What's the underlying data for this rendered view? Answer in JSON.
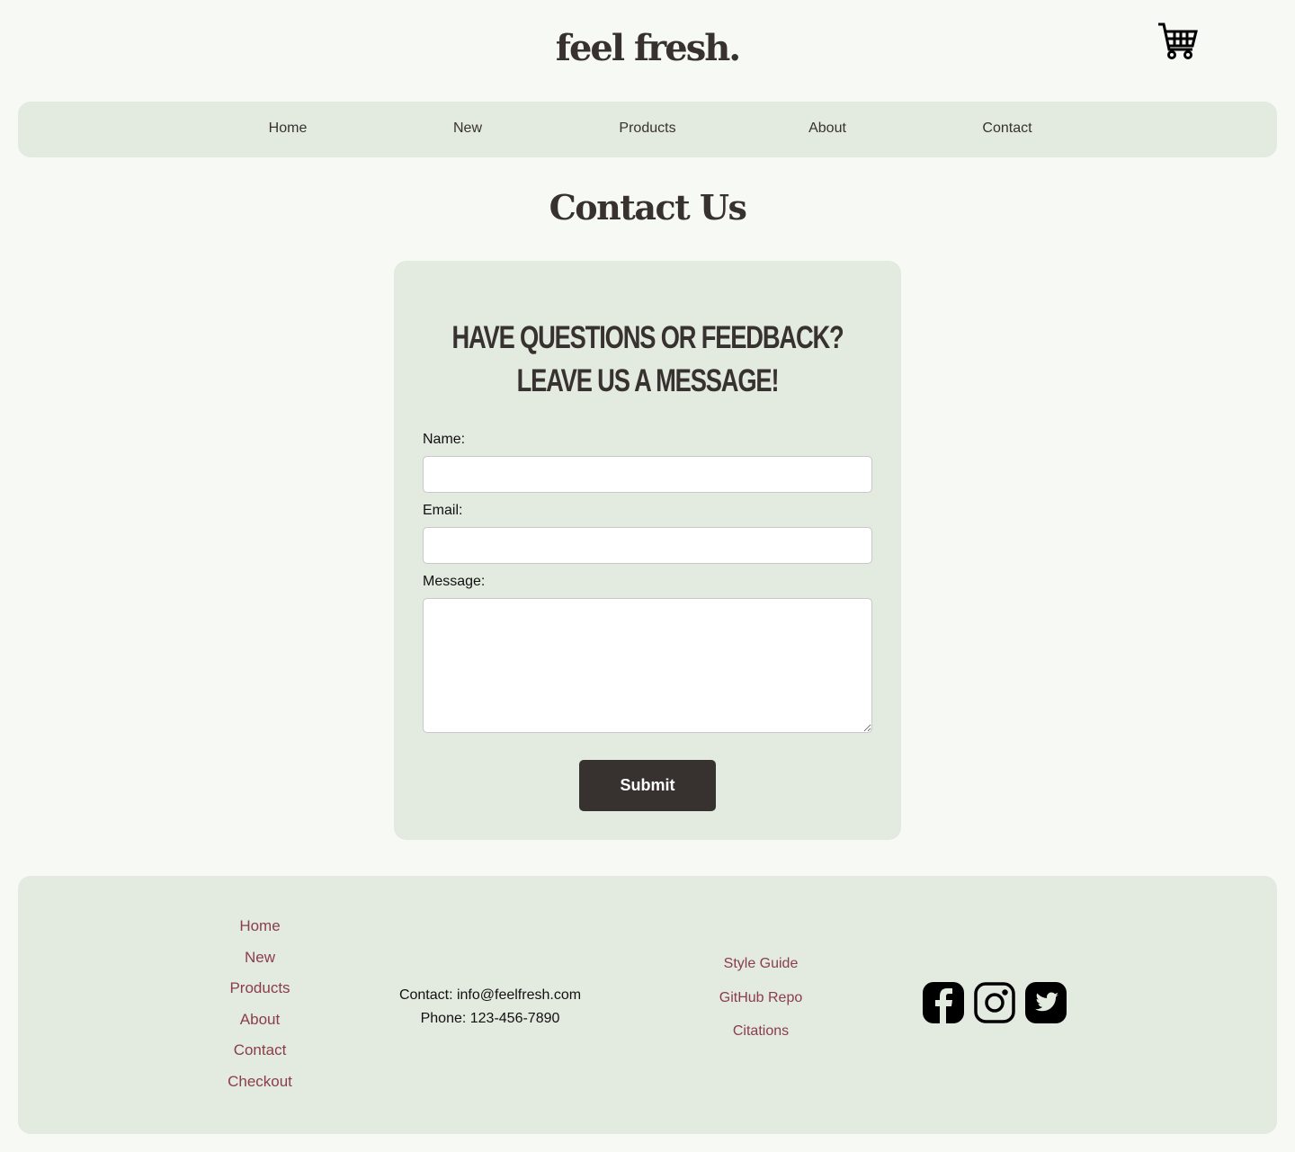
{
  "header": {
    "logo": "feel fresh.",
    "cart_icon": "cart-icon"
  },
  "nav": [
    "Home",
    "New",
    "Products",
    "About",
    "Contact"
  ],
  "page_title": "Contact Us",
  "form": {
    "heading_line1": "Have questions or feedback?",
    "heading_line2": "Leave us a message!",
    "name_label": "Name:",
    "email_label": "Email:",
    "message_label": "Message:",
    "name_value": "",
    "email_value": "",
    "message_value": "",
    "submit": "Submit"
  },
  "footer": {
    "links": [
      "Home",
      "New",
      "Products",
      "About",
      "Contact",
      "Checkout"
    ],
    "contact": "Contact: info@feelfresh.com",
    "phone": "Phone: 123-456-7890",
    "resources": [
      "Style Guide",
      "GitHub Repo",
      "Citations"
    ],
    "social": [
      "facebook-icon",
      "instagram-icon",
      "twitter-icon"
    ]
  }
}
